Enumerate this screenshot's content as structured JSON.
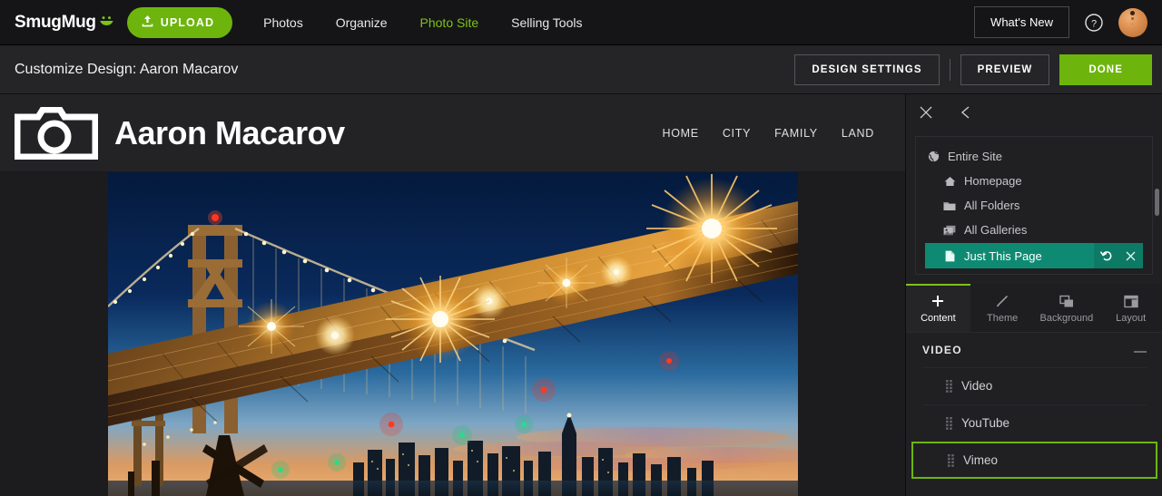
{
  "topnav": {
    "brand": "SmugMug",
    "brand_icon": "smugmug-smiley-icon",
    "upload_label": "UPLOAD",
    "upload_icon": "upload-arrow-icon",
    "upload_color": "#6db50d",
    "links": [
      {
        "label": "Photos",
        "active": false
      },
      {
        "label": "Organize",
        "active": false
      },
      {
        "label": "Photo Site",
        "active": true
      },
      {
        "label": "Selling Tools",
        "active": false
      }
    ],
    "active_link_color": "#7cc318",
    "whats_new_label": "What's New",
    "help_icon": "question-circle-icon",
    "avatar_icon": "user-avatar"
  },
  "customize_bar": {
    "title": "Customize Design: Aaron Macarov",
    "design_settings_label": "DESIGN SETTINGS",
    "preview_label": "PREVIEW",
    "done_label": "DONE",
    "done_color": "#6db50d"
  },
  "preview": {
    "site_logo_icon": "camera-icon",
    "site_title": "Aaron Macarov",
    "nav": [
      {
        "label": "HOME"
      },
      {
        "label": "CITY"
      },
      {
        "label": "FAMILY"
      },
      {
        "label": "LAND"
      }
    ],
    "photo_alt": "Bay Bridge at night with San Francisco skyline at sunset"
  },
  "panel": {
    "close_icon": "close-icon",
    "back_icon": "chevron-left-icon",
    "scope": [
      {
        "label": "Entire Site",
        "icon": "globe-icon",
        "level": 0,
        "selected": false
      },
      {
        "label": "Homepage",
        "icon": "home-icon",
        "level": 1,
        "selected": false
      },
      {
        "label": "All Folders",
        "icon": "folder-icon",
        "level": 1,
        "selected": false
      },
      {
        "label": "All Galleries",
        "icon": "galleries-icon",
        "level": 1,
        "selected": false
      },
      {
        "label": "Just This Page",
        "icon": "page-icon",
        "level": 1,
        "selected": true
      }
    ],
    "selected_color": "#0f8a72",
    "revert_icon": "undo-icon",
    "remove_icon": "close-icon",
    "tabs": [
      {
        "label": "Content",
        "icon": "plus-icon",
        "active": true
      },
      {
        "label": "Theme",
        "icon": "brush-icon",
        "active": false
      },
      {
        "label": "Background",
        "icon": "layers-icon",
        "active": false
      },
      {
        "label": "Layout",
        "icon": "layout-icon",
        "active": false
      }
    ],
    "active_tab_color": "#7cc318",
    "section": {
      "title": "VIDEO",
      "collapse_icon": "minus-icon",
      "items": [
        {
          "label": "Video",
          "icon": "drag-handle-icon",
          "highlighted": false
        },
        {
          "label": "YouTube",
          "icon": "drag-handle-icon",
          "highlighted": false
        },
        {
          "label": "Vimeo",
          "icon": "drag-handle-icon",
          "highlighted": true
        }
      ],
      "highlight_color": "#6db50d"
    }
  }
}
